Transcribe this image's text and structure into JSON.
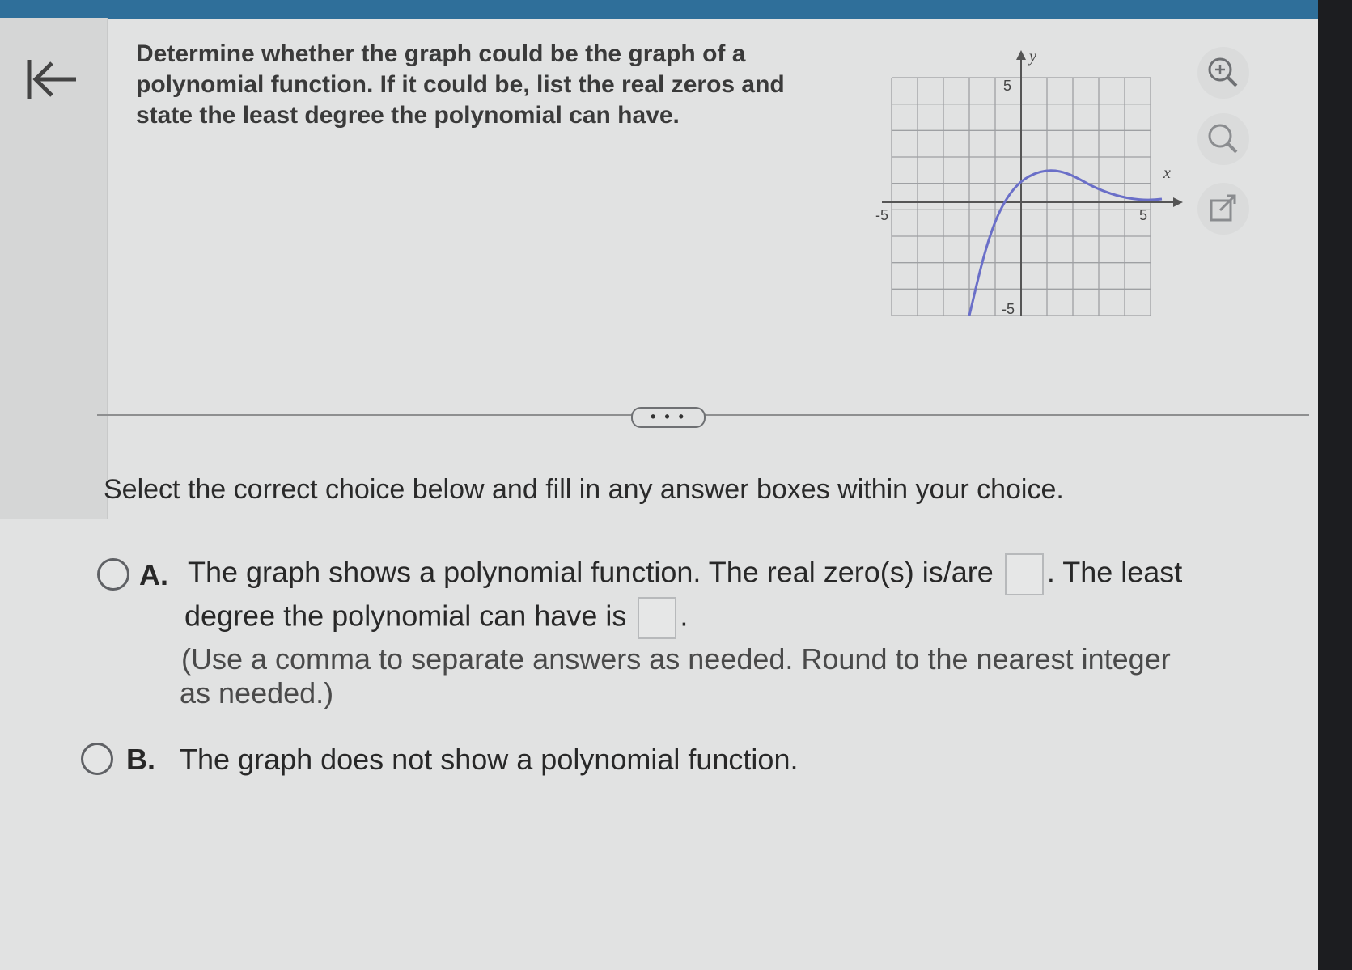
{
  "question": {
    "line1": "Determine whether the graph could be the graph of a",
    "line2": "polynomial function. If it could be, list the real zeros and",
    "line3": "state the least degree the polynomial can have."
  },
  "graph": {
    "x_label": "x",
    "y_label": "y",
    "tick_neg_x": "-5",
    "tick_pos_x": "5",
    "tick_pos_y": "5",
    "tick_neg_y": "-5",
    "curve_color": "#6a6fc8"
  },
  "tools": [
    "zoom-in-icon",
    "zoom-out-icon",
    "popout-icon"
  ],
  "more_label": "• • •",
  "instruction": "Select the correct choice below and fill in any answer boxes within your choice.",
  "choices": {
    "a": {
      "letter": "A.",
      "part1": "The graph shows a polynomial function. The real zero(s) is/are",
      "part2": ". The least",
      "part3": "degree the polynomial can have is",
      "part4": ".",
      "hint1": "(Use a comma to separate answers as needed.  Round to the nearest integer",
      "hint2": "as needed.)"
    },
    "b": {
      "letter": "B.",
      "text": "The graph does not show a polynomial function."
    }
  }
}
